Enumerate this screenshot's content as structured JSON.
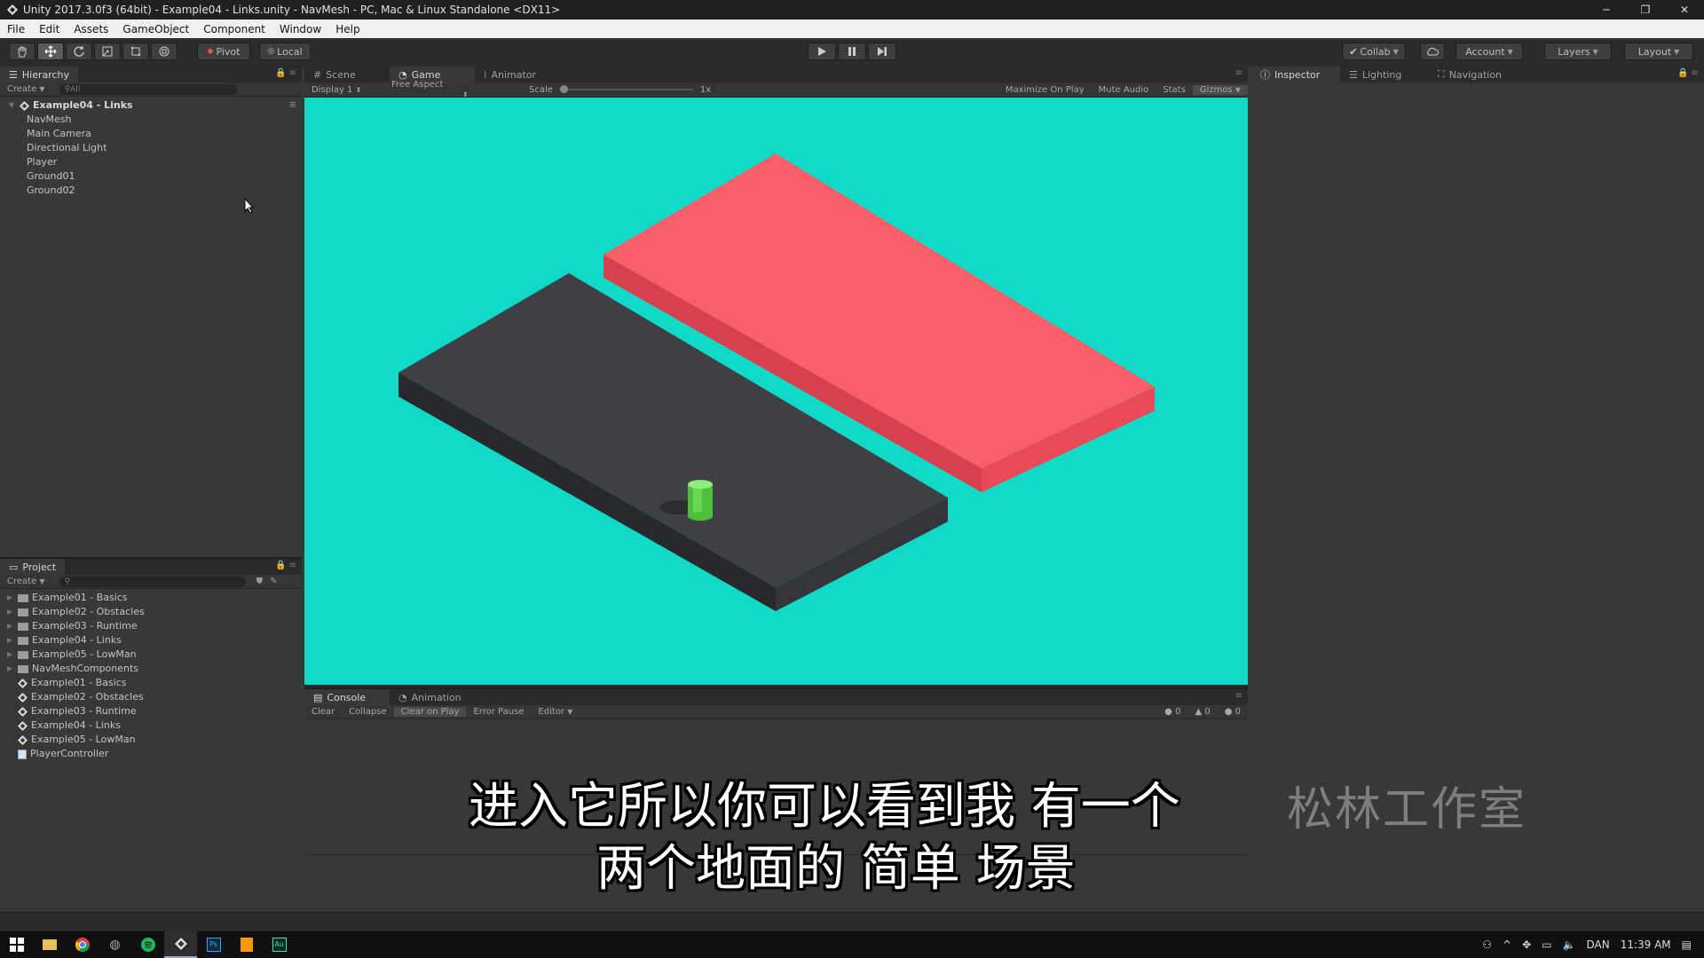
{
  "window": {
    "title": "Unity 2017.3.0f3 (64bit) - Example04 - Links.unity - NavMesh - PC, Mac & Linux Standalone <DX11>",
    "minimize": "─",
    "restore": "❐",
    "close": "✕"
  },
  "menu": [
    "File",
    "Edit",
    "Assets",
    "GameObject",
    "Component",
    "Window",
    "Help"
  ],
  "toolbar": {
    "pivot": "Pivot",
    "local": "Local",
    "collab": "Collab",
    "account": "Account",
    "layers": "Layers",
    "layout": "Layout"
  },
  "hierarchy": {
    "tab": "Hierarchy",
    "create": "Create",
    "search_placeholder": "All",
    "scene": "Example04 - Links",
    "items": [
      "NavMesh",
      "Main Camera",
      "Directional Light",
      "Player",
      "Ground01",
      "Ground02"
    ]
  },
  "project": {
    "tab": "Project",
    "create": "Create",
    "folders": [
      "Example01 - Basics",
      "Example02 - Obstacles",
      "Example03 - Runtime",
      "Example04 - Links",
      "Example05 - LowMan",
      "NavMeshComponents"
    ],
    "scenes": [
      "Example01 - Basics",
      "Example02 - Obstacles",
      "Example03 - Runtime",
      "Example04 - Links",
      "Example05 - LowMan"
    ],
    "script": "PlayerController"
  },
  "center": {
    "tabs": [
      "Scene",
      "Game",
      "Animator"
    ],
    "display": "Display 1",
    "aspect": "Free Aspect",
    "scale_label": "Scale",
    "scale_value": "1x",
    "maximize": "Maximize On Play",
    "mute": "Mute Audio",
    "stats": "Stats",
    "gizmos": "Gizmos"
  },
  "console": {
    "tabs": [
      "Console",
      "Animation"
    ],
    "buttons": [
      "Clear",
      "Collapse",
      "Clear on Play",
      "Error Pause",
      "Editor"
    ],
    "counts": {
      "info": "0",
      "warn": "0",
      "error": "0"
    }
  },
  "inspector": {
    "tabs": [
      "Inspector",
      "Lighting",
      "Navigation"
    ]
  },
  "subtitles": {
    "line1": "进入它所以你可以看到我 有一个",
    "line2": "两个地面的 简单 场景",
    "watermark": "松林工作室"
  },
  "taskbar": {
    "lang": "DAN",
    "time": "11:39 AM"
  },
  "colors": {
    "viewport_bg": "#11d9c7",
    "ground_dark": "#3f4046",
    "ground_red": "#f85f69",
    "player": "#5fd04a"
  }
}
